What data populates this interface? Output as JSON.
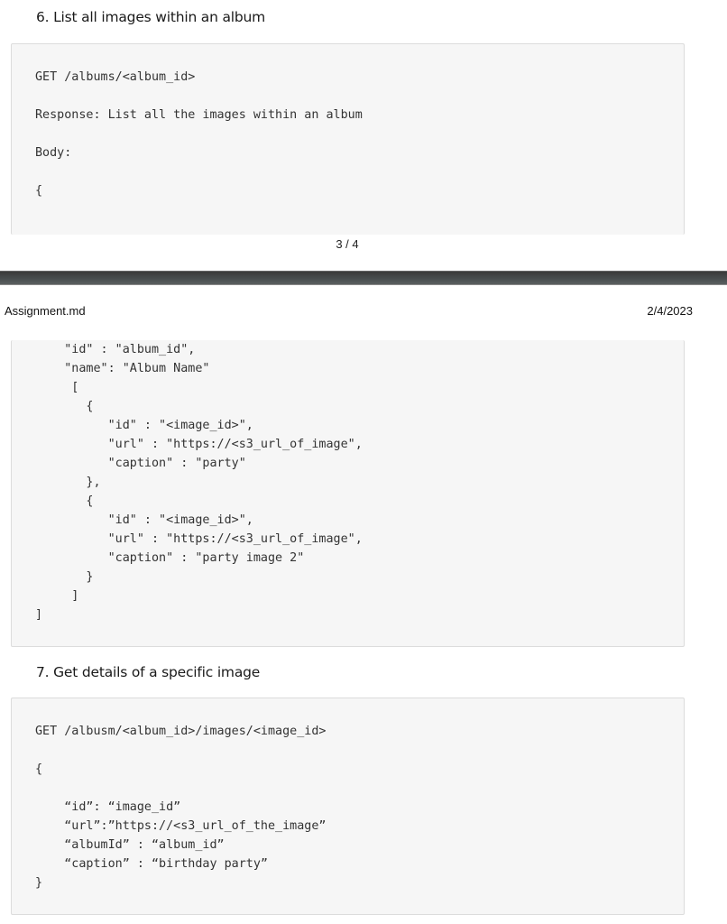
{
  "page_top": {
    "section6_heading": "6. List all images within an album",
    "code_lines": [
      "GET /albums/<album_id>",
      "Response: List all the images within an album",
      "Body:",
      "{"
    ],
    "page_number": "3 / 4"
  },
  "page_bottom": {
    "header": {
      "file_name": "Assignment.md",
      "date": "2/4/2023"
    },
    "continued_code_lines": [
      "    \"id\" : \"album_id\",",
      "    \"name\": \"Album Name\"",
      "     [",
      "       {",
      "          \"id\" : \"<image_id>\",",
      "          \"url\" : \"https://<s3_url_of_image\",",
      "          \"caption\" : \"party\"",
      "       },",
      "       {",
      "          \"id\" : \"<image_id>\",",
      "          \"url\" : \"https://<s3_url_of_image\",",
      "          \"caption\" : \"party image 2\"",
      "       }",
      "     ]",
      "]"
    ],
    "section7_heading": "7. Get details of a specific image",
    "section7_code_lines": [
      "GET /albusm/<album_id>/images/<image_id>",
      "{",
      "    “id”: “image_id”",
      "    “url”:”https://<s3_url_of_the_image”",
      "    “albumId” : “album_id”",
      "    “caption” : “birthday party”",
      "}"
    ]
  }
}
